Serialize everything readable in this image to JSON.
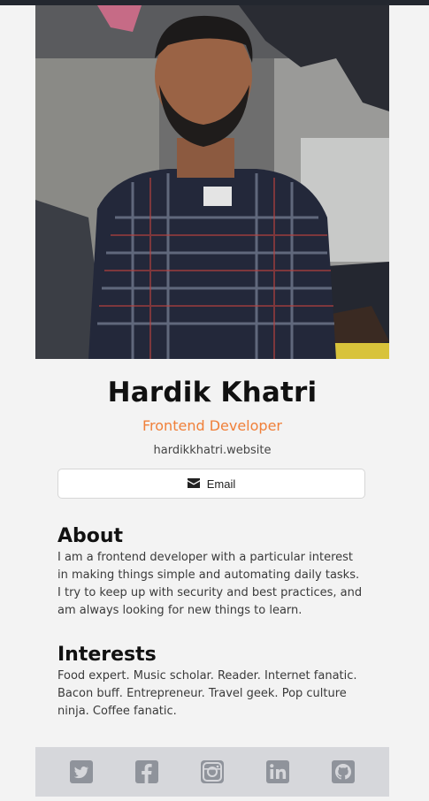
{
  "profile": {
    "name": "Hardik Khatri",
    "title": "Frontend Developer",
    "website": "hardikkhatri.website",
    "photo_alt": "Hardik Khatri"
  },
  "actions": {
    "email_label": "Email",
    "email_icon": "envelope-icon"
  },
  "about": {
    "heading": "About",
    "text": "I am a frontend developer with a particular interest in making things simple and automating daily tasks. I try to keep up with security and best practices, and am always looking for new things to learn."
  },
  "interests": {
    "heading": "Interests",
    "text": "Food expert. Music scholar. Reader. Internet fanatic. Bacon buff. Entrepreneur. Travel geek. Pop culture ninja. Coffee fanatic."
  },
  "footer": {
    "social": [
      "twitter-icon",
      "facebook-icon",
      "instagram-icon",
      "linkedin-icon",
      "github-icon"
    ]
  },
  "colors": {
    "accent": "#f0803a",
    "footer_bg": "#d6d7db",
    "icon": "#8f939b"
  }
}
